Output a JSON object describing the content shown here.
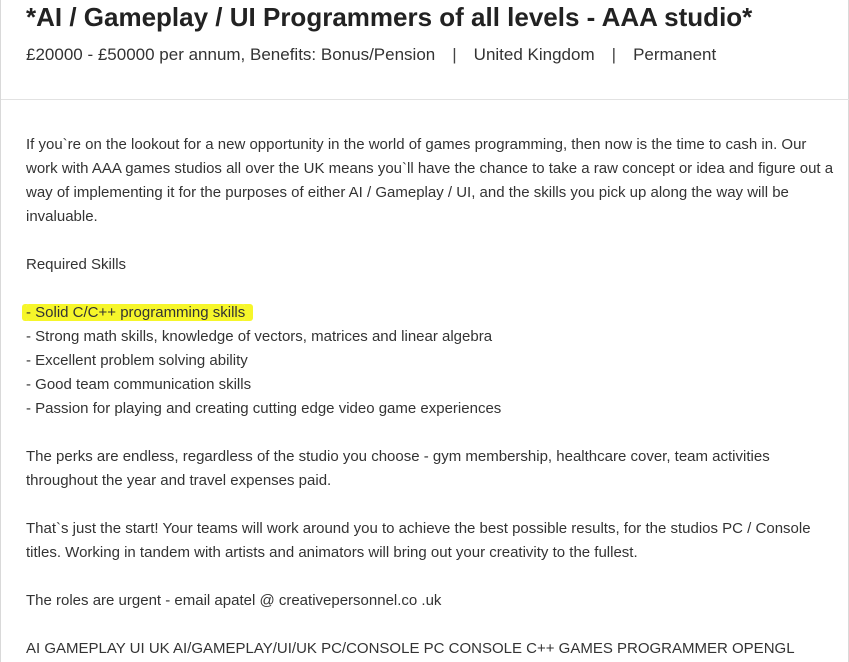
{
  "job": {
    "title": "*AI / Gameplay / UI Programmers of all levels - AAA studio*",
    "salary": "£20000 - £50000 per annum, Benefits: Bonus/Pension",
    "separator": "|",
    "location": "United Kingdom",
    "type": "Permanent"
  },
  "description": {
    "intro": "If you`re on the lookout for a new opportunity in the world of games programming, then now is the time to cash in. Our work with AAA games studios all over the UK means you`ll have the chance to take a raw concept or idea and figure out a way of implementing it for the purposes of either AI / Gameplay / UI, and the skills you pick up along the way will be invaluable.",
    "skills_heading": "Required Skills",
    "skills": [
      "- Solid C/C++ programming skills",
      "- Strong math skills, knowledge of vectors, matrices and linear algebra",
      "- Excellent problem solving ability",
      "- Good team communication skills",
      "- Passion for playing and creating cutting edge video game experiences"
    ],
    "perks": "The perks are endless, regardless of the studio you choose - gym membership, healthcare cover, team activities throughout the year and travel expenses paid.",
    "start": "That`s just the start! Your teams will work around you to achieve the best possible results, for the studios PC / Console titles. Working in tandem with artists and animators will bring out your creativity to the fullest.",
    "contact": "The roles are urgent - email apatel @ creativepersonnel.co .uk",
    "tags": "AI GAMEPLAY UI UK AI/GAMEPLAY/UI/UK PC/CONSOLE PC CONSOLE C++ GAMES PROGRAMMER OPENGL"
  },
  "colors": {
    "highlight": "#f6f62a"
  }
}
